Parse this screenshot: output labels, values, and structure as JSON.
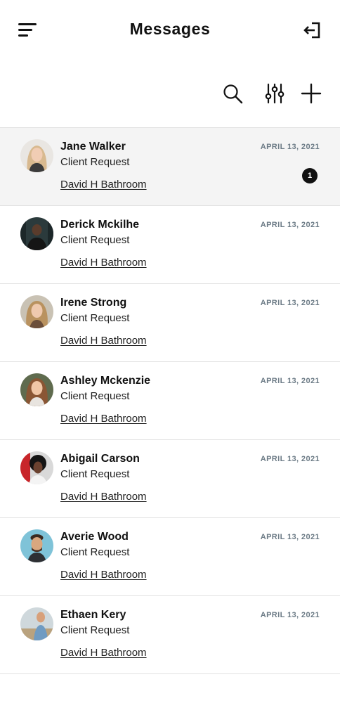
{
  "header": {
    "title": "Messages",
    "menu_icon": "hamburger-menu-icon",
    "logout_icon": "logout-icon"
  },
  "toolbar": {
    "search_icon": "search-icon",
    "filter_icon": "sliders-filter-icon",
    "add_icon": "plus-icon"
  },
  "colors": {
    "date": "#6c7b86",
    "active_row": "#f4f4f4",
    "divider": "#e2e2e2",
    "badge": "#111111"
  },
  "messages": [
    {
      "name": "Jane Walker",
      "subject": "Client Request",
      "project": "David H Bathroom",
      "date": "APRIL 13, 2021",
      "unread": "1"
    },
    {
      "name": "Derick Mckilhe",
      "subject": "Client Request",
      "project": "David H Bathroom",
      "date": "APRIL 13, 2021"
    },
    {
      "name": "Irene Strong",
      "subject": "Client Request",
      "project": "David H Bathroom",
      "date": "APRIL 13, 2021"
    },
    {
      "name": "Ashley Mckenzie",
      "subject": "Client Request",
      "project": "David H Bathroom",
      "date": "APRIL 13, 2021"
    },
    {
      "name": "Abigail Carson",
      "subject": "Client Request",
      "project": "David H Bathroom",
      "date": "APRIL 13, 2021"
    },
    {
      "name": "Averie Wood",
      "subject": "Client Request",
      "project": "David H Bathroom",
      "date": "APRIL 13, 2021"
    },
    {
      "name": "Ethaen Kery",
      "subject": "Client Request",
      "project": "David H Bathroom",
      "date": "APRIL 13, 2021"
    }
  ]
}
